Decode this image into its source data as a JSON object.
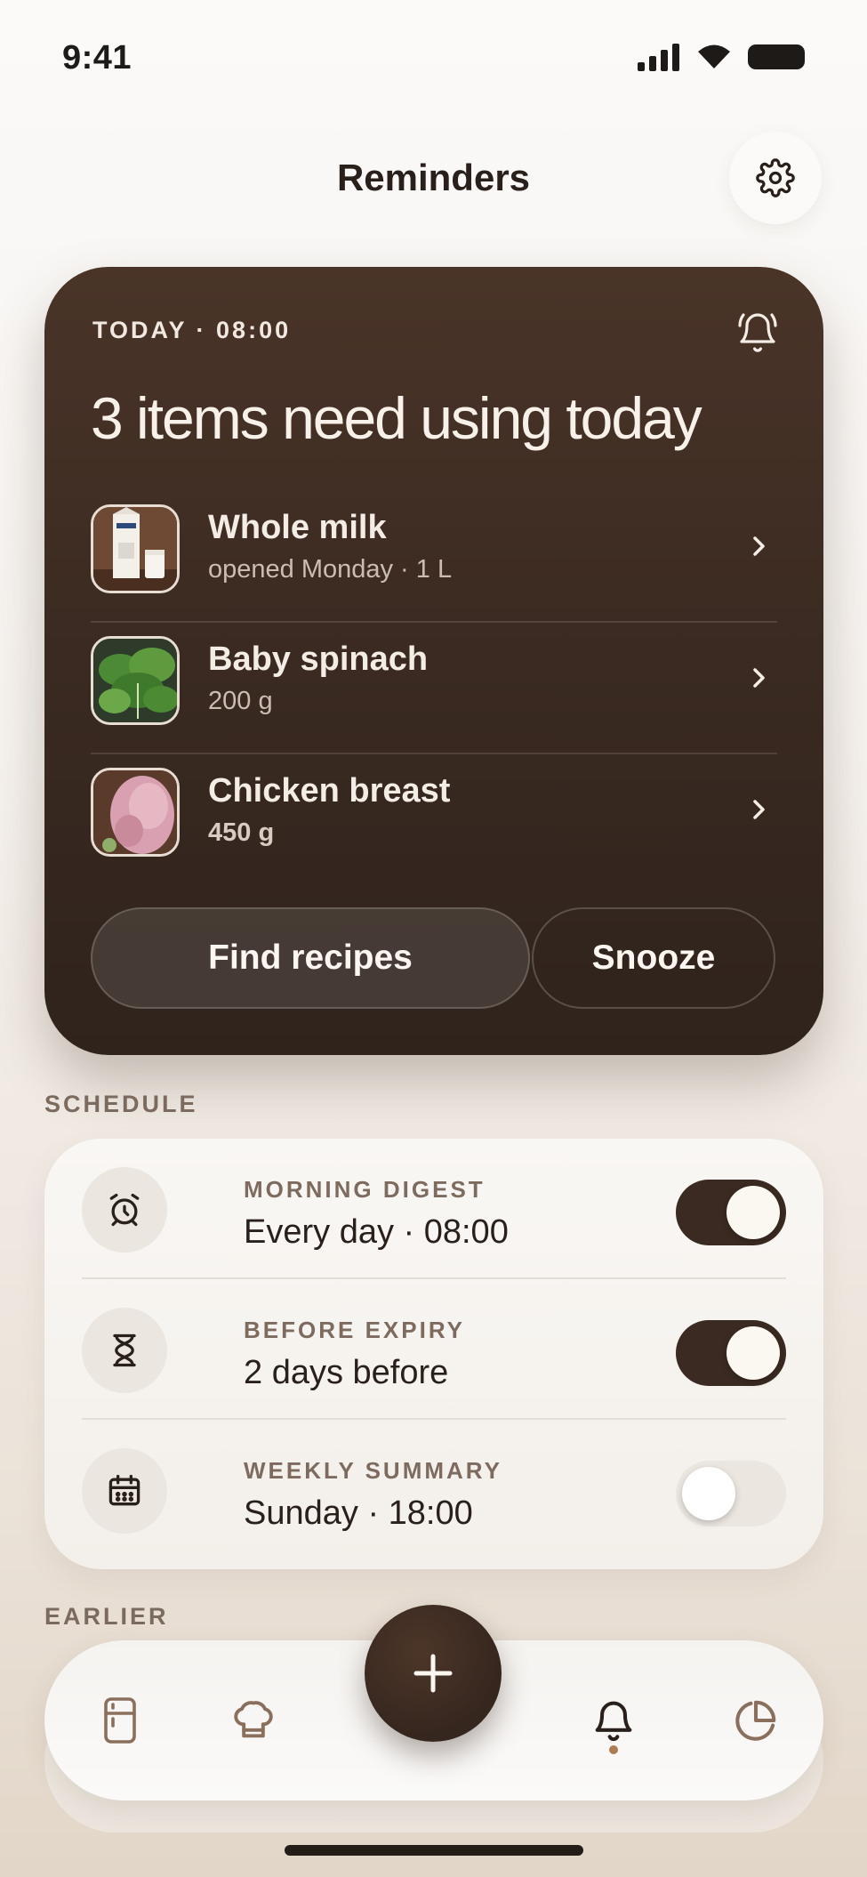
{
  "status_bar": {
    "time": "9:41"
  },
  "header": {
    "title": "Reminders"
  },
  "today": {
    "eyebrow": "TODAY · 08:00",
    "headline": "3 items need using today",
    "items": [
      {
        "name": "Whole milk",
        "detail": "opened Monday · 1 L",
        "thumb": "milk-carton"
      },
      {
        "name": "Baby spinach",
        "detail": "200 g",
        "thumb": "spinach"
      },
      {
        "name": "Chicken breast",
        "detail": "450 g",
        "thumb": "chicken"
      }
    ],
    "primary_action": "Find recipes",
    "secondary_action": "Snooze"
  },
  "schedule": {
    "label": "SCHEDULE",
    "rows": [
      {
        "eyebrow": "MORNING DIGEST",
        "value": "Every day · 08:00",
        "icon": "alarm-clock-icon",
        "enabled": true
      },
      {
        "eyebrow": "BEFORE EXPIRY",
        "value": "2 days before",
        "icon": "hourglass-icon",
        "enabled": true
      },
      {
        "eyebrow": "WEEKLY SUMMARY",
        "value": "Sunday · 18:00",
        "icon": "calendar-icon",
        "enabled": false
      }
    ]
  },
  "earlier": {
    "label": "EARLIER"
  },
  "tabbar": {
    "tabs": [
      "fridge-icon",
      "chef-hat-icon",
      "plus-icon",
      "bell-icon",
      "pie-chart-icon"
    ],
    "active": "bell-icon"
  },
  "colors": {
    "card_dark": "#3a2a21",
    "accent_dot": "#b07c54",
    "background": "#f6f2ee"
  }
}
